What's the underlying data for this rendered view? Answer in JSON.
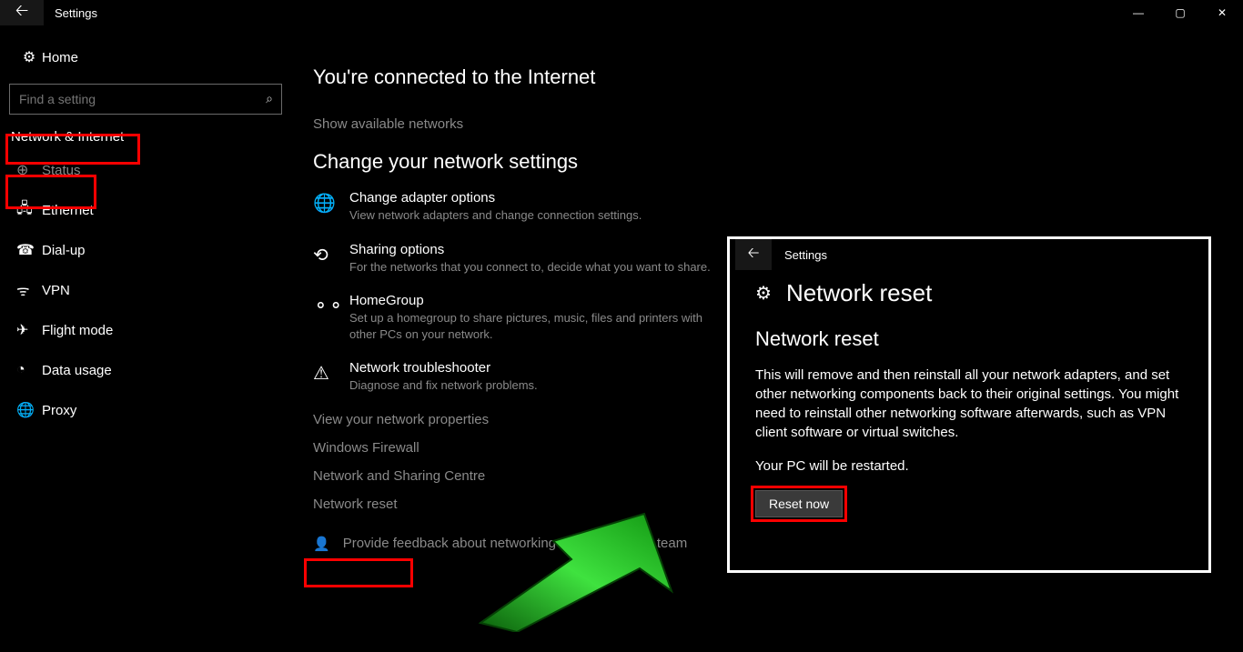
{
  "titlebar": {
    "title": "Settings"
  },
  "sidebar": {
    "home_label": "Home",
    "search_placeholder": "Find a setting",
    "category": "Network & Internet",
    "items": [
      {
        "label": "Status"
      },
      {
        "label": "Ethernet"
      },
      {
        "label": "Dial-up"
      },
      {
        "label": "VPN"
      },
      {
        "label": "Flight mode"
      },
      {
        "label": "Data usage"
      },
      {
        "label": "Proxy"
      }
    ]
  },
  "main": {
    "heading_connected": "You're connected to the Internet",
    "show_networks": "Show available networks",
    "heading_change": "Change your network settings",
    "options": [
      {
        "title": "Change adapter options",
        "desc": "View network adapters and change connection settings."
      },
      {
        "title": "Sharing options",
        "desc": "For the networks that you connect to, decide what you want to share."
      },
      {
        "title": "HomeGroup",
        "desc": "Set up a homegroup to share pictures, music, files and printers with other PCs on your network."
      },
      {
        "title": "Network troubleshooter",
        "desc": "Diagnose and fix network problems."
      }
    ],
    "links": [
      "View your network properties",
      "Windows Firewall",
      "Network and Sharing Centre",
      "Network reset"
    ],
    "feedback": "Provide feedback about networking to the Windows team"
  },
  "inset": {
    "tb_title": "Settings",
    "page_title": "Network reset",
    "subheading": "Network reset",
    "body1": "This will remove and then reinstall all your network adapters, and set other networking components back to their original settings. You might need to reinstall other networking software afterwards, such as VPN client software or virtual switches.",
    "body2": "Your PC will be restarted.",
    "button": "Reset now"
  }
}
